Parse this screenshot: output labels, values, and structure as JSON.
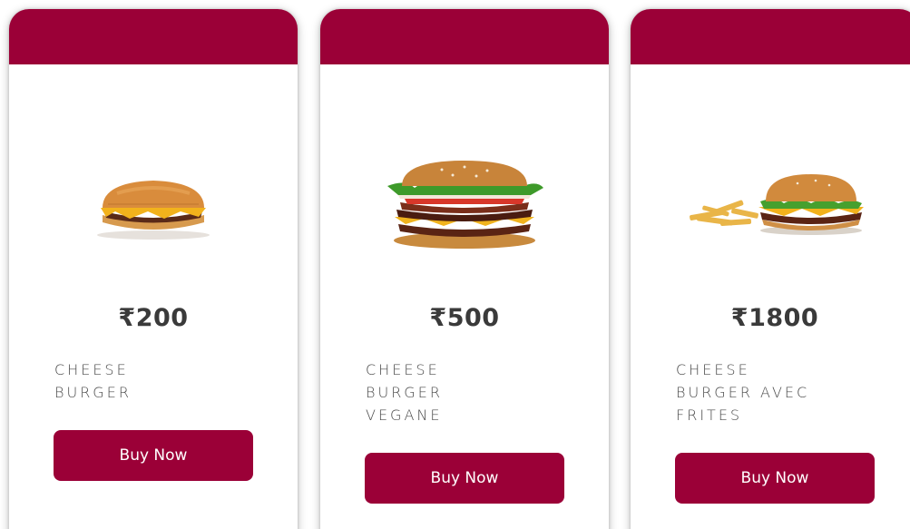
{
  "theme": {
    "accent": "#9b0037",
    "card_background": "#ffffff",
    "text_color": "#3a3a3a"
  },
  "products": [
    {
      "image_icon": "cheeseburger-image",
      "price": "₹200",
      "name_lines": [
        "CHEESE",
        "BURGER"
      ],
      "button_label": "Buy Now"
    },
    {
      "image_icon": "stacked-burger-image",
      "price": "₹500",
      "name_lines": [
        "CHEESE",
        "BURGER",
        "VEGANE"
      ],
      "button_label": "Buy Now"
    },
    {
      "image_icon": "burger-with-fries-image",
      "price": "₹1800",
      "name_lines": [
        "CHEESE",
        "BURGER AVEC",
        "FRITES"
      ],
      "button_label": "Buy Now"
    }
  ]
}
